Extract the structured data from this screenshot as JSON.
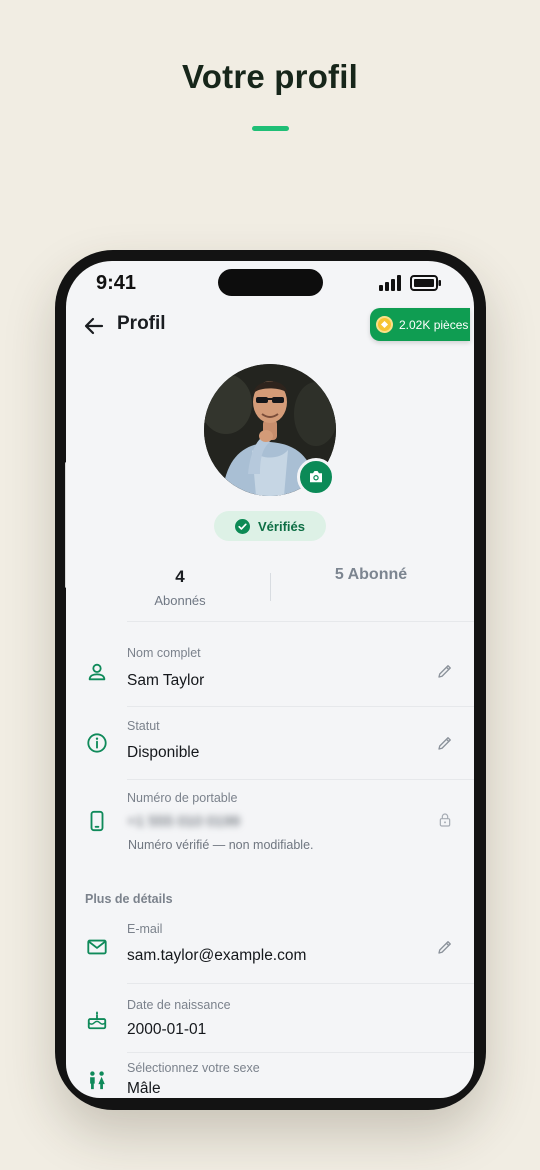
{
  "page": {
    "title": "Votre profil",
    "accent": "#1fbf76",
    "background": "#f1ede3"
  },
  "status_bar": {
    "time": "9:41"
  },
  "header": {
    "title": "Profil",
    "back_icon": "arrow-left-icon"
  },
  "coins": {
    "label": "2.02K pièces",
    "icon": "coin-icon",
    "color": "#0f9d52"
  },
  "profile": {
    "verified_label": "Vérifiés",
    "camera_icon": "camera-icon"
  },
  "stats": {
    "left": {
      "value": "4",
      "label": "Abonnés"
    },
    "right": {
      "label": "5 Abonné"
    }
  },
  "fields": {
    "full_name": {
      "label": "Nom complet",
      "value": "Sam Taylor",
      "icon": "person-icon",
      "action_icon": "pencil-icon"
    },
    "status": {
      "label": "Statut",
      "value": "Disponible",
      "icon": "info-icon",
      "action_icon": "pencil-icon"
    },
    "mobile": {
      "label": "Numéro de portable",
      "value": "+1 555 010 0199",
      "note": "Numéro vérifié — non modifiable.",
      "icon": "smartphone-icon",
      "action_icon": "lock-icon"
    }
  },
  "more_details": {
    "title": "Plus de détails",
    "email": {
      "label": "E-mail",
      "value": "sam.taylor@example.com",
      "icon": "mail-icon",
      "action_icon": "pencil-icon"
    },
    "birthday": {
      "label": "Date de naissance",
      "value": "2000-01-01",
      "icon": "cake-icon"
    },
    "gender": {
      "label": "Sélectionnez votre sexe",
      "value": "Mâle",
      "icon": "people-icon"
    }
  },
  "colors": {
    "brand": "#0b8a57",
    "icon": "#0f8a5a",
    "muted": "#7b828c"
  }
}
